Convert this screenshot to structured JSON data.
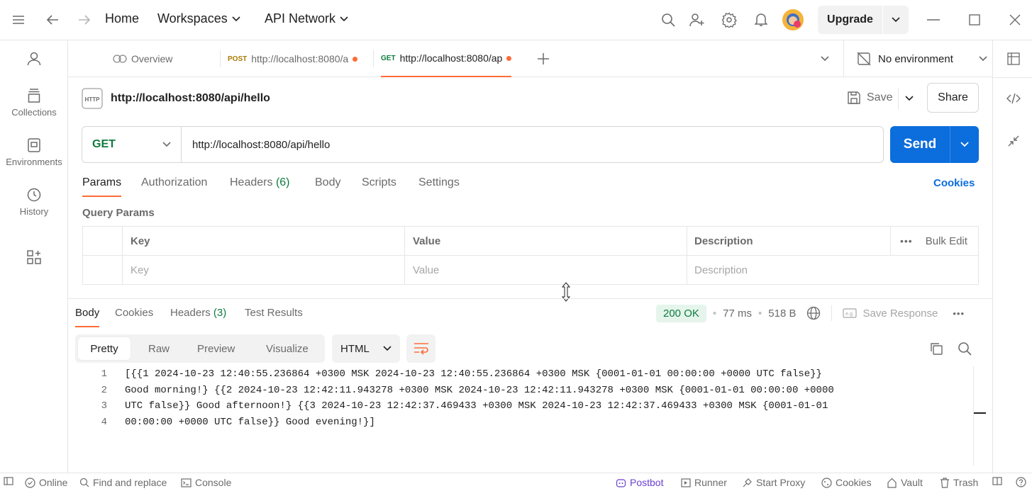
{
  "topbar": {
    "home": "Home",
    "workspaces": "Workspaces",
    "api_network": "API Network",
    "upgrade": "Upgrade"
  },
  "tabs": {
    "overview": "Overview",
    "tab1_method": "POST",
    "tab1_url": "http://localhost:8080/a",
    "tab2_method": "GET",
    "tab2_url": "http://localhost:8080/ap"
  },
  "environment": "No environment",
  "sidebar": {
    "collections": "Collections",
    "environments": "Environments",
    "history": "History"
  },
  "request": {
    "title": "http://localhost:8080/api/hello",
    "save": "Save",
    "share": "Share",
    "method": "GET",
    "url": "http://localhost:8080/api/hello",
    "send": "Send",
    "tabs": {
      "params": "Params",
      "authorization": "Authorization",
      "headers": "Headers",
      "headers_count": "(6)",
      "body": "Body",
      "scripts": "Scripts",
      "settings": "Settings",
      "cookies": "Cookies"
    },
    "query_params": "Query Params",
    "table": {
      "key_header": "Key",
      "value_header": "Value",
      "description_header": "Description",
      "bulk_edit": "Bulk Edit",
      "key_placeholder": "Key",
      "value_placeholder": "Value",
      "description_placeholder": "Description"
    }
  },
  "response": {
    "tabs": {
      "body": "Body",
      "cookies": "Cookies",
      "headers": "Headers",
      "headers_count": "(3)",
      "test_results": "Test Results"
    },
    "status": "200 OK",
    "time": "77 ms",
    "size": "518 B",
    "save_response": "Save Response",
    "views": {
      "pretty": "Pretty",
      "raw": "Raw",
      "preview": "Preview",
      "visualize": "Visualize"
    },
    "format": "HTML",
    "lines": [
      {
        "n": "1",
        "text": "[{{1 2024-10-23 12:40:55.236864 +0300 MSK 2024-10-23 12:40:55.236864 +0300 MSK {0001-01-01 00:00:00 +0000 UTC false}}"
      },
      {
        "n": "2",
        "text": "Good morning!} {{2 2024-10-23 12:42:11.943278 +0300 MSK 2024-10-23 12:42:11.943278 +0300 MSK {0001-01-01 00:00:00 +0000"
      },
      {
        "n": "3",
        "text": "UTC false}} Good afternoon!} {{3 2024-10-23 12:42:37.469433 +0300 MSK 2024-10-23 12:42:37.469433 +0300 MSK {0001-01-01"
      },
      {
        "n": "4",
        "text": "00:00:00 +0000 UTC false}} Good evening!}]"
      }
    ]
  },
  "statusbar": {
    "online": "Online",
    "find_replace": "Find and replace",
    "console": "Console",
    "postbot": "Postbot",
    "runner": "Runner",
    "start_proxy": "Start Proxy",
    "cookies": "Cookies",
    "vault": "Vault",
    "trash": "Trash"
  },
  "colors": {
    "accent": "#ff6c37",
    "send_blue": "#0c6ddc",
    "get_green": "#0f7b3f",
    "post_yellow": "#ad7a03",
    "status_ok_bg": "#e5f5ec",
    "postbot_purple": "#6b3fd2"
  }
}
